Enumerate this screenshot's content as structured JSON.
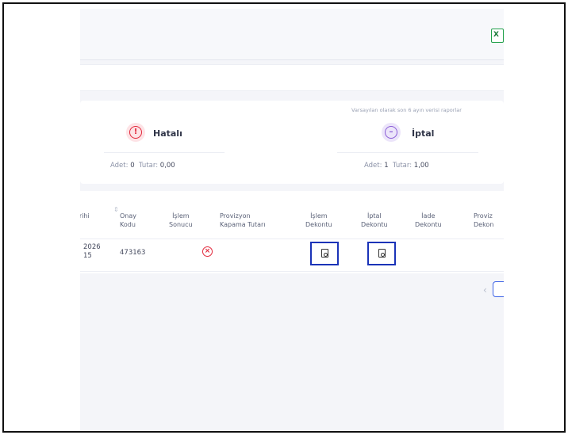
{
  "toolbar": {
    "excel_icon": "excel-icon",
    "excel_glyph": "X"
  },
  "summary": {
    "note": "Varsayılan olarak son 6 ayın verisi raporlar",
    "error_card": {
      "title": "Hatalı",
      "count_label": "Adet:",
      "count": "0",
      "amount_label": "Tutar:",
      "amount": "0,00",
      "icon": "alert-circle-icon",
      "color": "#e2293c"
    },
    "cancel_card": {
      "title": "İptal",
      "count_label": "Adet:",
      "count": "1",
      "amount_label": "Tutar:",
      "amount": "1,00",
      "icon": "minus-circle-icon",
      "color": "#8a5cd6"
    }
  },
  "table": {
    "columns": [
      {
        "line1": "arihi",
        "line2": ""
      },
      {
        "line1": "Onay",
        "line2": "Kodu"
      },
      {
        "line1": "İşlem",
        "line2": "Sonucu"
      },
      {
        "line1": "Provizyon",
        "line2": "Kapama Tutarı"
      },
      {
        "line1": "İşlem",
        "line2": "Dekontu"
      },
      {
        "line1": "İptal",
        "line2": "Dekontu"
      },
      {
        "line1": "İade",
        "line2": "Dekontu"
      },
      {
        "line1": "Proviz",
        "line2": "Dekon"
      }
    ],
    "rows": [
      {
        "date_line1": "2026",
        "date_line2": "15",
        "approval_code": "473163",
        "result_icon": "error-circle-icon",
        "provision_amount": "",
        "islem_receipt_icon": "pdf-icon",
        "iptal_receipt_icon": "pdf-icon"
      }
    ]
  },
  "pagination": {
    "prev_icon": "chevron-left-icon",
    "prev_glyph": "‹"
  }
}
